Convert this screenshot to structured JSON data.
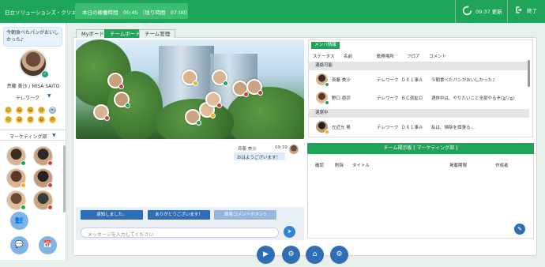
{
  "topbar": {
    "brand": "日立ソリューションズ・クリエイト",
    "worktime": "本日の稼働時間　00:45 （残り時間　07:00）",
    "clock": "09:37 更新",
    "logout": "終了"
  },
  "profile": {
    "message": "今朝食べたパンがおいしかった♪",
    "name": "斉藤 美沙 / MISA SAITO",
    "status": "テレワーク",
    "department": "マーケティング部"
  },
  "emojis": [
    "😊",
    "😃",
    "😄",
    "😢",
    "👻",
    "😐",
    "😅",
    "😍",
    "😆",
    "😠"
  ],
  "tabs": [
    "Myボード",
    "チームボード",
    "チーム管理"
  ],
  "chat": {
    "sender": "斉藤 美沙",
    "time": "09:39",
    "message": "おはようございます！",
    "quick_replies": [
      "承知しました。",
      "ありがとうございます！",
      "簡易コメントボタン3"
    ],
    "input_placeholder": "メッセージを入力してください"
  },
  "members_panel": {
    "title": "メンバ情報",
    "headers": [
      "ステータス",
      "名前",
      "勤務場所",
      "フロア",
      "コメント"
    ],
    "groups": [
      {
        "label": "連絡可能",
        "rows": [
          {
            "name": "斉藤 美沙",
            "location": "テレワーク",
            "floor": "ＤＸ１事Ａ",
            "comment": "今朝食べたパンがおいしかった♪"
          },
          {
            "name": "野口 亜弥",
            "location": "テレワーク",
            "floor": "ＢＣ就拡Ｄ",
            "comment": "週休中は、やりたいこと全部やるぞ(≧▽≦)"
          }
        ]
      },
      {
        "label": "退席中",
        "rows": [
          {
            "name": "左近允 晃",
            "location": "テレワーク",
            "floor": "ＤＸ１事Ａ",
            "comment": "私は、掃除を頑張る…"
          }
        ]
      }
    ]
  },
  "board": {
    "title": "チーム掲示板 [ マーケティング部 ]",
    "headers": [
      "確認",
      "削除",
      "タイトル",
      "掲載期限",
      "作成者"
    ]
  }
}
